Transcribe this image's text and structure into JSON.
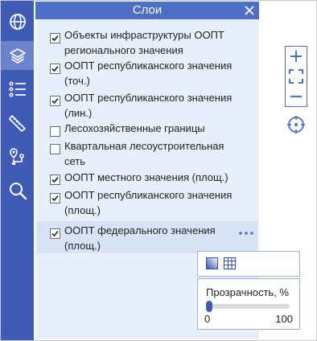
{
  "panel": {
    "title": "Слои"
  },
  "layers": [
    {
      "label": "Объекты инфраструктуры ООПТ регионального значения",
      "checked": true
    },
    {
      "label": "ООПТ республиканского значения (точ.)",
      "checked": true
    },
    {
      "label": "ООПТ республиканского значения (лин.)",
      "checked": true
    },
    {
      "label": "Лесохозяйственные границы",
      "checked": false
    },
    {
      "label": "Квартальная лесоустроительная сеть",
      "checked": false
    },
    {
      "label": "ООПТ местного значения (площ.)",
      "checked": true
    },
    {
      "label": "ООПТ республиканского значения (площ.)",
      "checked": true
    },
    {
      "label": "ООПТ федерального значения (площ.)",
      "checked": true
    }
  ],
  "opacity": {
    "label": "Прозрачность, %",
    "min": "0",
    "max": "100",
    "value": 0
  },
  "sidebar": {
    "items": [
      {
        "icon": "globe-icon"
      },
      {
        "icon": "layers-icon",
        "active": true
      },
      {
        "icon": "list-icon"
      },
      {
        "icon": "ruler-icon"
      },
      {
        "icon": "route-icon"
      },
      {
        "icon": "search-icon"
      }
    ]
  },
  "colors": {
    "sidebar": "#3f5bb5",
    "sidebar_active": "#6b82cf",
    "header": "#4f6fc7",
    "panel_bg": "#e7effb",
    "selected_row": "#d8e3f6"
  }
}
